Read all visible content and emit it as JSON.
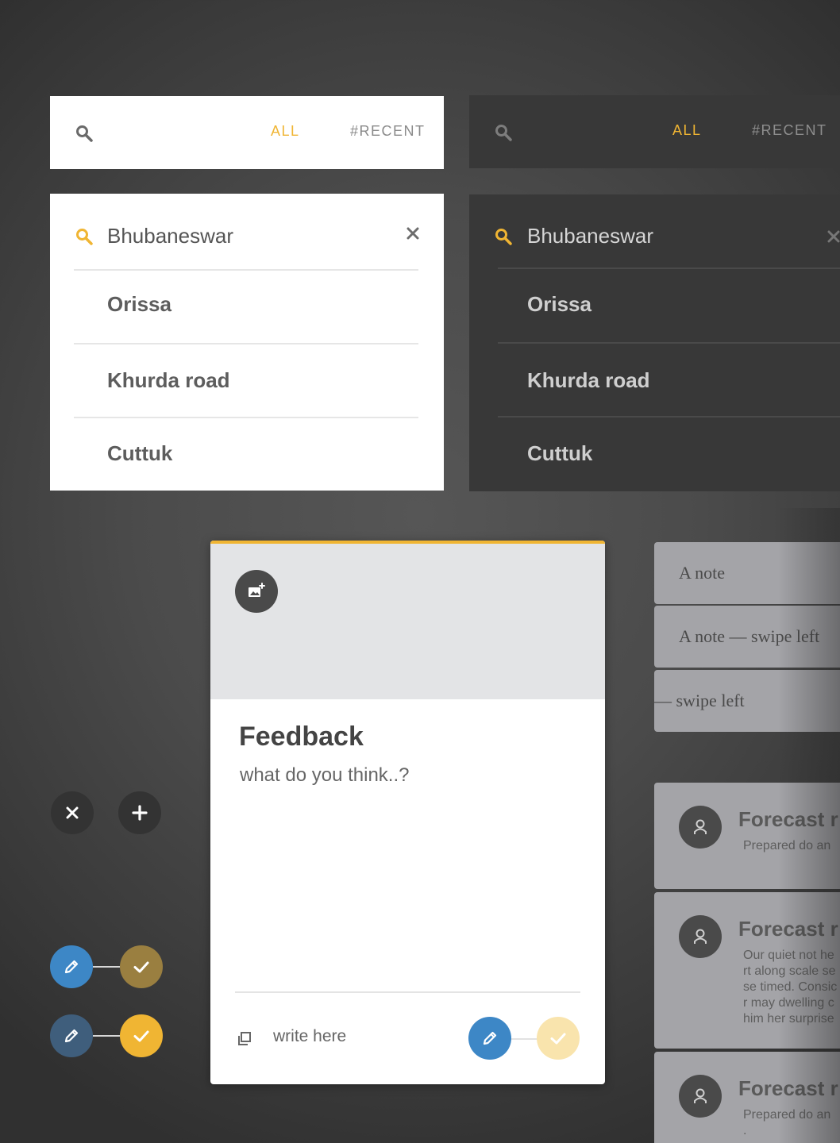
{
  "search_bars": {
    "light": {
      "tabs": [
        {
          "label": "ALL"
        },
        {
          "label": "#RECENT"
        }
      ],
      "icon": "search-icon"
    },
    "dark": {
      "tabs": [
        {
          "label": "ALL"
        },
        {
          "label": "#RECENT"
        }
      ],
      "icon": "search-icon"
    }
  },
  "dropdown_light": {
    "query": "Bhubaneswar",
    "suggestions": [
      {
        "label": "Orissa"
      },
      {
        "label": "Khurda road"
      },
      {
        "label": "Cuttuk"
      }
    ]
  },
  "dropdown_dark": {
    "query": "Bhubaneswar",
    "suggestions": [
      {
        "label": "Orissa"
      },
      {
        "label": "Khurda road"
      },
      {
        "label": "Cuttuk"
      }
    ]
  },
  "feedback_card": {
    "title": "Feedback",
    "subtitle": "what do you think..?",
    "input_placeholder": "write here",
    "accent_color": "#f0b533"
  },
  "notes": [
    {
      "text": "A note"
    },
    {
      "text": "A note — swipe left"
    },
    {
      "text": "— swipe left"
    }
  ],
  "forecasts": [
    {
      "title": "Forecast r",
      "lines": [
        "Prepared do an"
      ]
    },
    {
      "title": "Forecast r",
      "lines": [
        "Our quiet not he",
        "rt along scale se",
        "se timed. Consic",
        "r may dwelling c",
        " him her surprise"
      ]
    },
    {
      "title": "Forecast r",
      "lines": [
        "Prepared do an",
        "."
      ]
    }
  ],
  "colors": {
    "accent_yellow": "#f0b533",
    "blue": "#3d87c6",
    "slate_blue": "#3f5e7c",
    "olive": "#9a7f40",
    "pale_yellow": "#f9e4ad",
    "dark_button": "#333333"
  }
}
